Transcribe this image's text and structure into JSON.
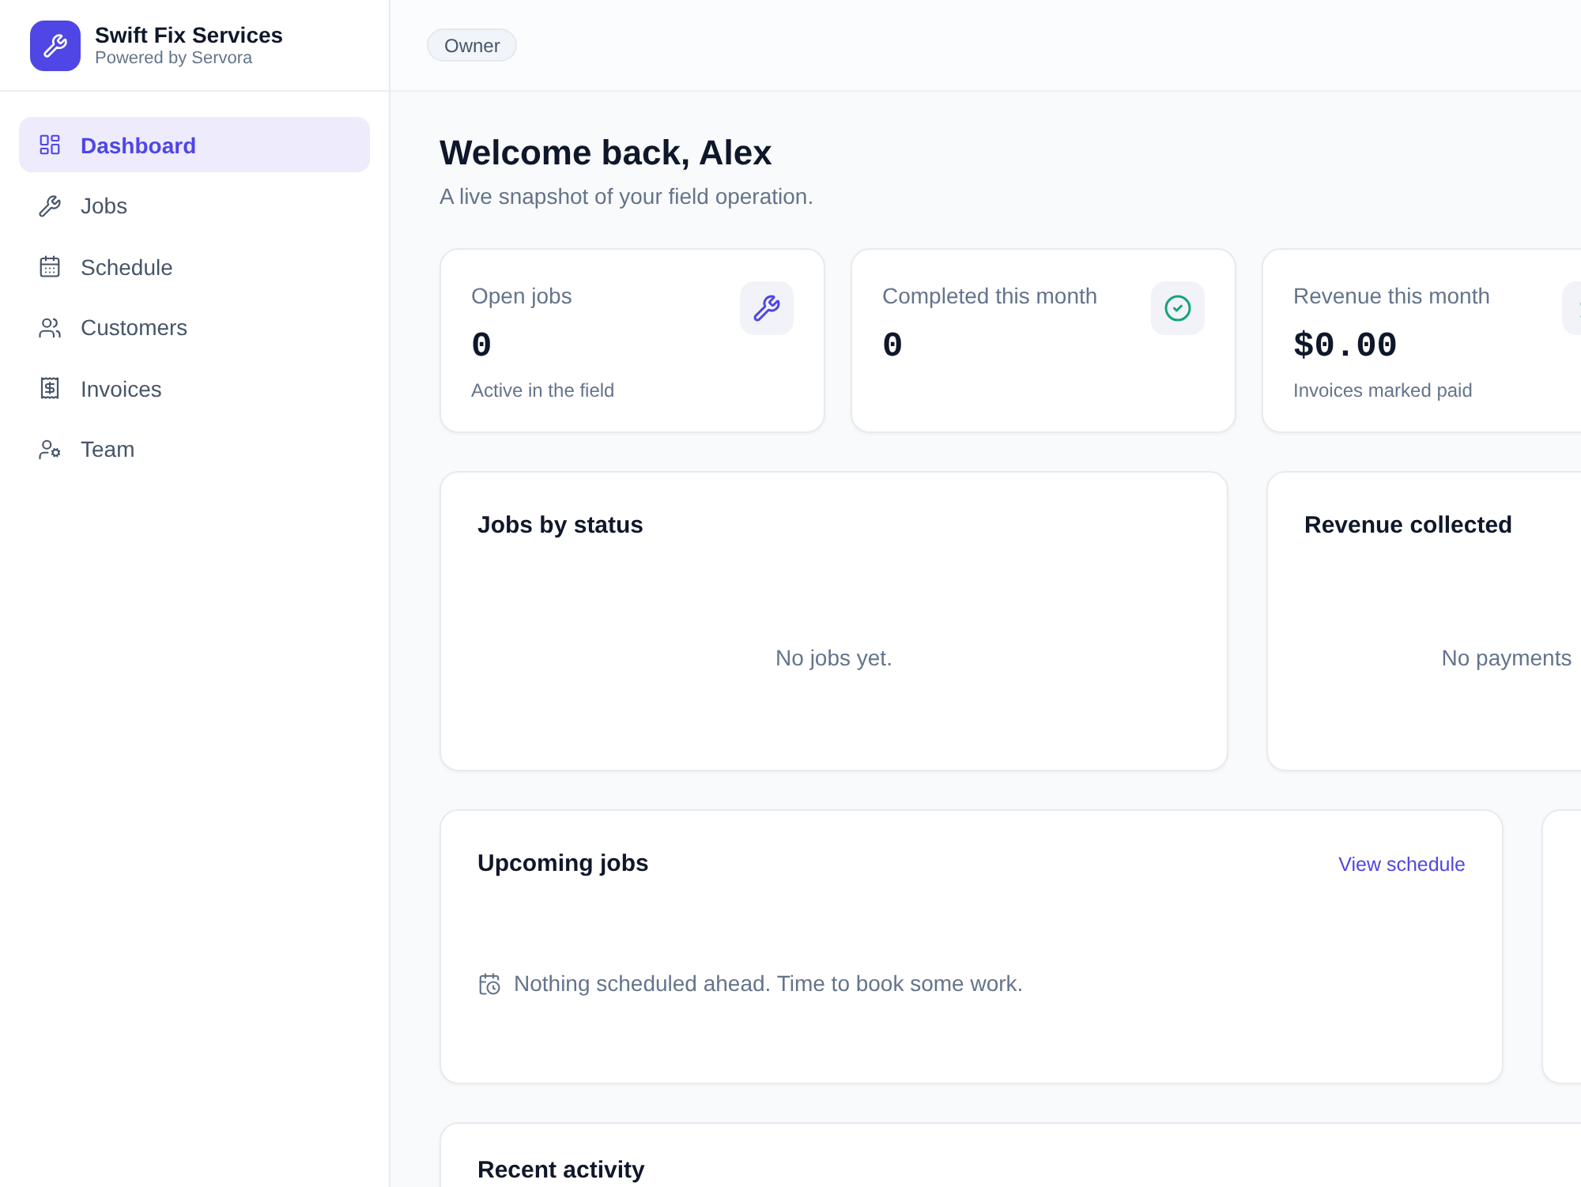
{
  "sidebar": {
    "brand": {
      "name": "Swift Fix Services",
      "tagline": "Powered by Servora"
    },
    "nav": [
      {
        "label": "Dashboard",
        "selected": true
      },
      {
        "label": "Jobs",
        "selected": false
      },
      {
        "label": "Schedule",
        "selected": false
      },
      {
        "label": "Customers",
        "selected": false
      },
      {
        "label": "Invoices",
        "selected": false
      },
      {
        "label": "Team",
        "selected": false
      }
    ]
  },
  "topbar": {
    "role_badge": "Owner"
  },
  "header": {
    "title": "Welcome back, Alex",
    "subtitle": "A live snapshot of your field operation."
  },
  "stats": [
    {
      "label": "Open jobs",
      "value": "0",
      "note": "Active in the field"
    },
    {
      "label": "Completed this month",
      "value": "0"
    },
    {
      "label": "Revenue this month",
      "value": "$0.00",
      "note": "Invoices marked paid"
    }
  ],
  "charts": [
    {
      "title": "Jobs by status",
      "empty_message": "No jobs yet."
    },
    {
      "title": "Revenue collected",
      "empty_message": "No payments"
    }
  ],
  "upcoming_jobs": {
    "title": "Upcoming jobs",
    "link": "View schedule",
    "empty_message": "Nothing scheduled ahead. Time to book some work."
  },
  "recent_activity": {
    "title": "Recent activity"
  }
}
